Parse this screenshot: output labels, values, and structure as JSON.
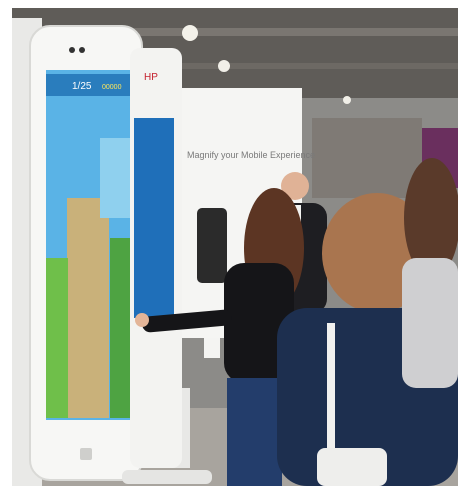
{
  "photo": {
    "description_visible_text": {
      "booth_banner": "Magnify your Mobile Experience",
      "brand_mark": "HP"
    },
    "game_hud": {
      "level": "1/25",
      "score": "00000"
    }
  }
}
